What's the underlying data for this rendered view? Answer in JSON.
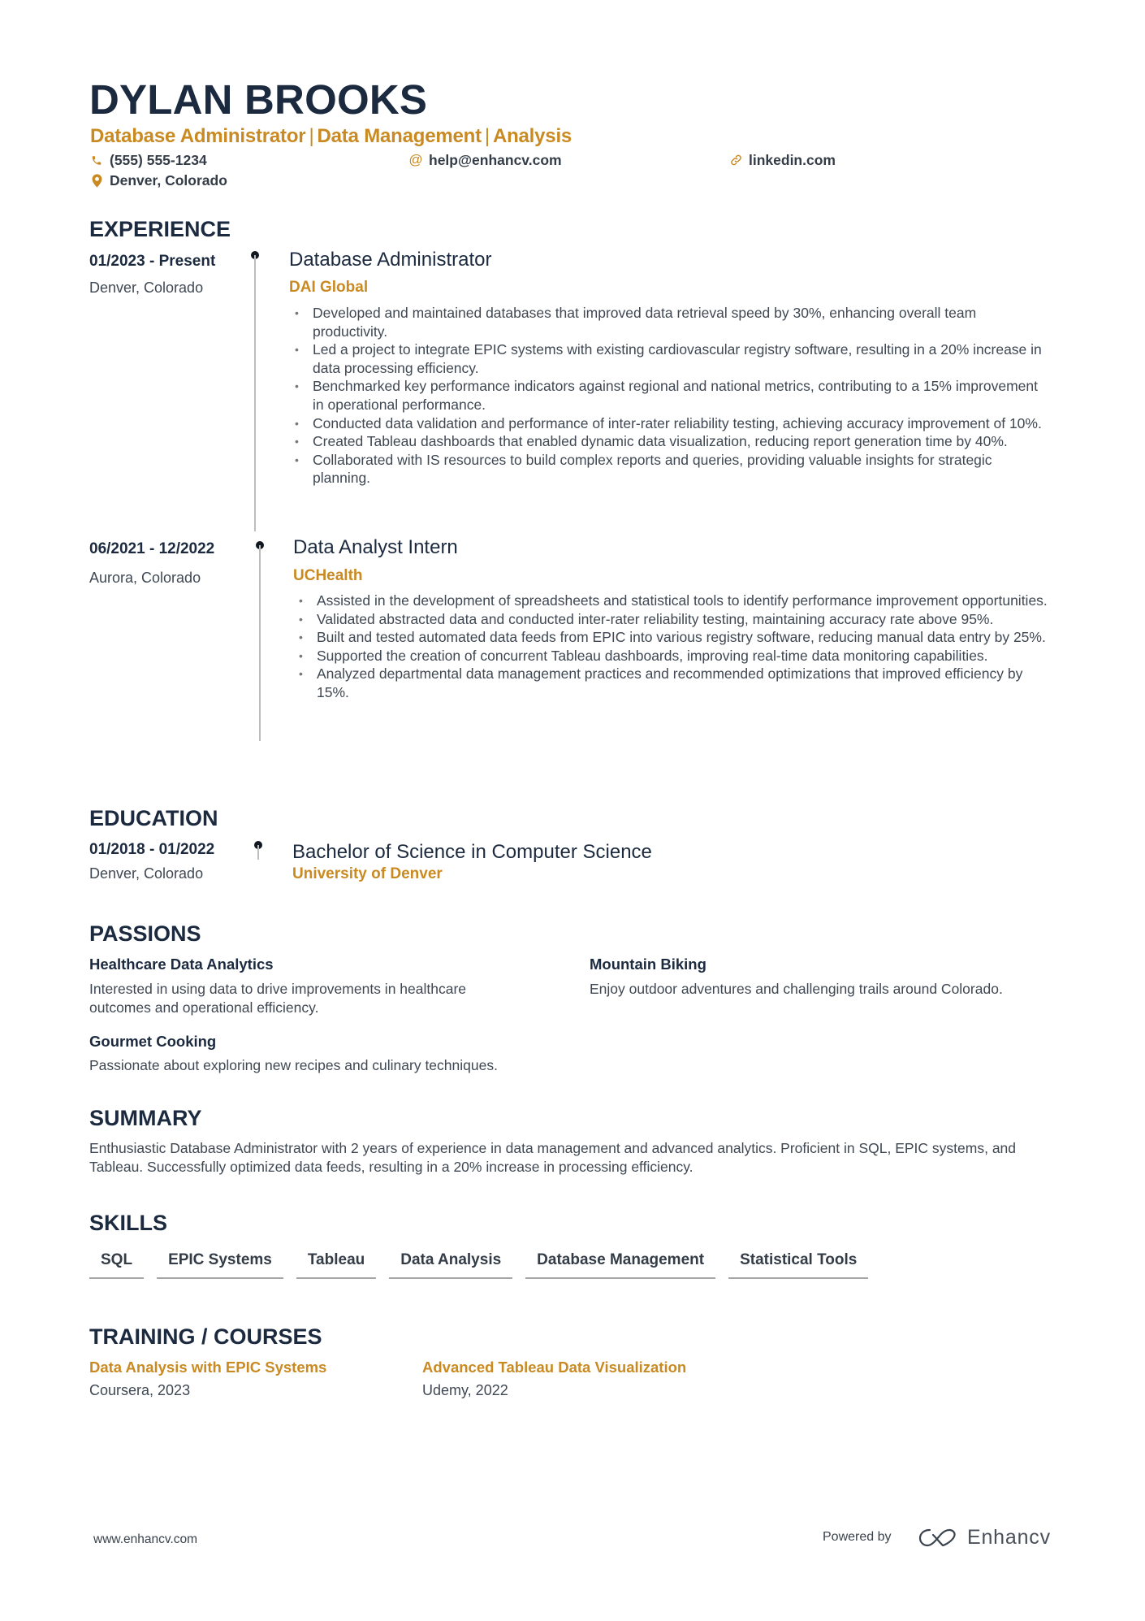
{
  "header": {
    "name": "DYLAN BROOKS",
    "subtitle_parts": [
      "Database Administrator",
      "Data Management",
      "Analysis"
    ],
    "separator": "|",
    "contacts": {
      "phone": {
        "icon": "phone-icon",
        "text": "(555) 555-1234"
      },
      "email": {
        "icon": "at-icon",
        "text": "help@enhancv.com"
      },
      "linkedin": {
        "icon": "link-icon",
        "text": "linkedin.com"
      },
      "location": {
        "icon": "location-pin-icon",
        "text": "Denver, Colorado"
      }
    }
  },
  "colors": {
    "navy": "#1c2a3f",
    "gold": "#c98a22",
    "body_text": "#3f4853"
  },
  "sections": {
    "experience": "EXPERIENCE",
    "education": "EDUCATION",
    "passions": "PASSIONS",
    "summary": "SUMMARY",
    "skills": "SKILLS",
    "training": "TRAINING / COURSES"
  },
  "experience": [
    {
      "dates": "01/2023 - Present",
      "location": "Denver, Colorado",
      "title": "Database Administrator",
      "company": "DAI Global",
      "bullets": [
        "Developed and maintained databases that improved data retrieval speed by 30%, enhancing overall team productivity.",
        "Led a project to integrate EPIC systems with existing cardiovascular registry software, resulting in a 20% increase in data processing efficiency.",
        "Benchmarked key performance indicators against regional and national metrics, contributing to a 15% improvement in operational performance.",
        "Conducted data validation and performance of inter-rater reliability testing, achieving accuracy improvement of 10%.",
        "Created Tableau dashboards that enabled dynamic data visualization, reducing report generation time by 40%.",
        "Collaborated with IS resources to build complex reports and queries, providing valuable insights for strategic planning."
      ]
    },
    {
      "dates": "06/2021 - 12/2022",
      "location": "Aurora, Colorado",
      "title": "Data Analyst Intern",
      "company": "UCHealth",
      "bullets": [
        "Assisted in the development of spreadsheets and statistical tools to identify performance improvement opportunities.",
        "Validated abstracted data and conducted inter-rater reliability testing, maintaining accuracy rate above 95%.",
        "Built and tested automated data feeds from EPIC into various registry software, reducing manual data entry by 25%.",
        "Supported the creation of concurrent Tableau dashboards, improving real-time data monitoring capabilities.",
        "Analyzed departmental data management practices and recommended optimizations that improved efficiency by 15%."
      ]
    }
  ],
  "education": [
    {
      "dates": "01/2018 - 01/2022",
      "location": "Denver, Colorado",
      "degree": "Bachelor of Science in Computer Science",
      "school": "University of Denver"
    }
  ],
  "passions": [
    {
      "title": "Healthcare Data Analytics",
      "description": "Interested in using data to drive improvements in healthcare outcomes and operational efficiency."
    },
    {
      "title": "Mountain Biking",
      "description": "Enjoy outdoor adventures and challenging trails around Colorado."
    },
    {
      "title": "Gourmet Cooking",
      "description": "Passionate about exploring new recipes and culinary techniques."
    }
  ],
  "summary": "Enthusiastic Database Administrator with 2 years of experience in data management and advanced analytics. Proficient in SQL, EPIC systems, and Tableau. Successfully optimized data feeds, resulting in a 20% increase in processing efficiency.",
  "skills": [
    "SQL",
    "EPIC Systems",
    "Tableau",
    "Data Analysis",
    "Database Management",
    "Statistical Tools"
  ],
  "training": [
    {
      "title": "Data Analysis with EPIC Systems",
      "provider": "Coursera, 2023"
    },
    {
      "title": "Advanced Tableau Data Visualization",
      "provider": "Udemy, 2022"
    }
  ],
  "footer": {
    "url": "www.enhancv.com",
    "powered_by": "Powered by",
    "brand": "Enhancv",
    "brand_icon": "enhancv-logo-icon"
  }
}
